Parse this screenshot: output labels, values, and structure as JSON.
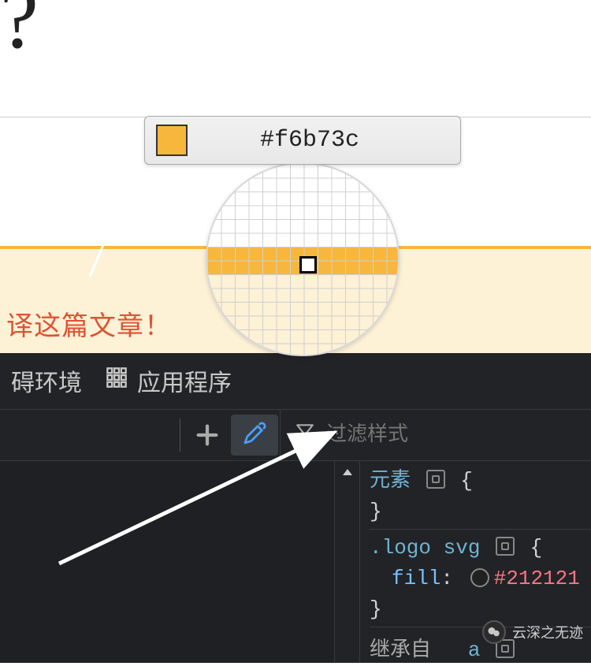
{
  "page_top": {
    "question_mark": "?"
  },
  "eyedropper": {
    "hex": "#f6b73c",
    "swatch_color": "#f6b73c"
  },
  "banner": {
    "text": "译这篇文章！"
  },
  "devtools": {
    "tabs": {
      "a11y": "碍环境",
      "app": "应用程序"
    },
    "filter_placeholder": "过滤样式",
    "rules": {
      "element": {
        "selector": "元素",
        "open": "{",
        "close": "}"
      },
      "logo": {
        "selector": ".logo svg",
        "open": "{",
        "prop": "fill",
        "colon": ":",
        "value": "#212121",
        "close": "}"
      },
      "inherit": {
        "label": "继承自",
        "tag": "a"
      }
    }
  },
  "watermark": {
    "text": "云深之无迹"
  }
}
